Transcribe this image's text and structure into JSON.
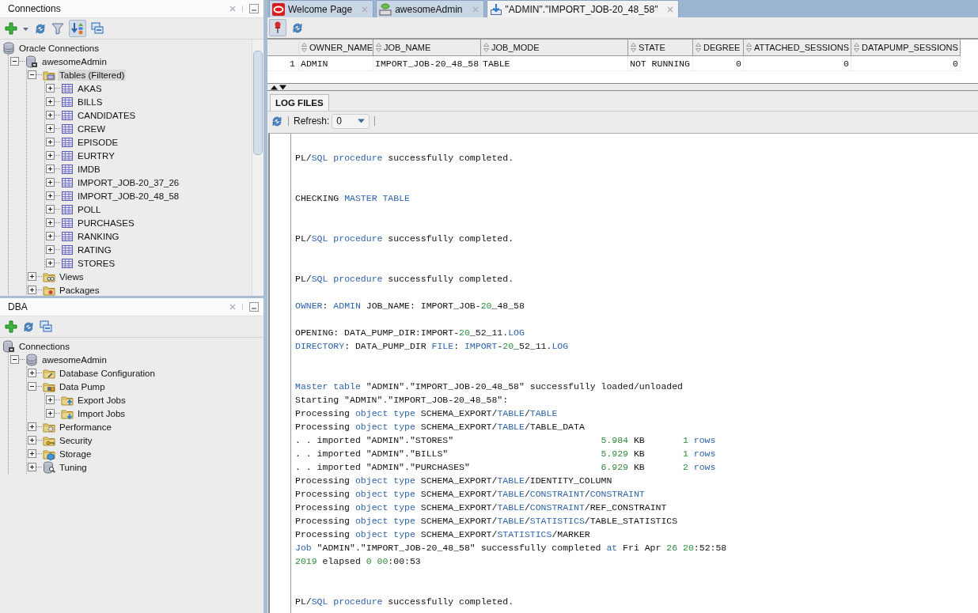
{
  "connections_panel": {
    "title": "Connections",
    "tree": [
      {
        "label": "Oracle Connections",
        "kind": "database",
        "selected": false,
        "children": [
          {
            "label": "awesomeAdmin",
            "kind": "connection",
            "expanded": true,
            "selected": false,
            "children": [
              {
                "label": "Tables (Filtered)",
                "kind": "tablefolder",
                "expanded": true,
                "selected": true,
                "children": [
                  {
                    "label": "AKAS",
                    "kind": "table",
                    "expanded": false,
                    "selected": false
                  },
                  {
                    "label": "BILLS",
                    "kind": "table",
                    "expanded": false,
                    "selected": false
                  },
                  {
                    "label": "CANDIDATES",
                    "kind": "table",
                    "expanded": false,
                    "selected": false
                  },
                  {
                    "label": "CREW",
                    "kind": "table",
                    "expanded": false,
                    "selected": false
                  },
                  {
                    "label": "EPISODE",
                    "kind": "table",
                    "expanded": false,
                    "selected": false
                  },
                  {
                    "label": "EURTRY",
                    "kind": "table",
                    "expanded": false,
                    "selected": false
                  },
                  {
                    "label": "IMDB",
                    "kind": "table",
                    "expanded": false,
                    "selected": false
                  },
                  {
                    "label": "IMPORT_JOB-20_37_26",
                    "kind": "table",
                    "expanded": false,
                    "selected": false
                  },
                  {
                    "label": "IMPORT_JOB-20_48_58",
                    "kind": "table",
                    "expanded": false,
                    "selected": false
                  },
                  {
                    "label": "POLL",
                    "kind": "table",
                    "expanded": false,
                    "selected": false
                  },
                  {
                    "label": "PURCHASES",
                    "kind": "table",
                    "expanded": false,
                    "selected": false
                  },
                  {
                    "label": "RANKING",
                    "kind": "table",
                    "expanded": false,
                    "selected": false
                  },
                  {
                    "label": "RATING",
                    "kind": "table",
                    "expanded": false,
                    "selected": false
                  },
                  {
                    "label": "STORES",
                    "kind": "table",
                    "expanded": false,
                    "selected": false
                  }
                ]
              },
              {
                "label": "Views",
                "kind": "viewsfolder",
                "expanded": false,
                "selected": false
              },
              {
                "label": "Packages",
                "kind": "packagesfolder",
                "expanded": false,
                "selected": false
              }
            ]
          }
        ]
      }
    ]
  },
  "dba_panel": {
    "title": "DBA",
    "tree": [
      {
        "label": "Connections",
        "kind": "connection",
        "selected": false,
        "children": [
          {
            "label": "awesomeAdmin",
            "kind": "database",
            "expanded": true,
            "selected": false,
            "children": [
              {
                "label": "Database Configuration",
                "kind": "configfolder",
                "expanded": false,
                "selected": false
              },
              {
                "label": "Data Pump",
                "kind": "pumpfolder",
                "expanded": true,
                "selected": false,
                "children": [
                  {
                    "label": "Export Jobs",
                    "kind": "exportfolder",
                    "expanded": false,
                    "selected": false
                  },
                  {
                    "label": "Import Jobs",
                    "kind": "importfolder",
                    "expanded": false,
                    "selected": false
                  }
                ]
              },
              {
                "label": "Performance",
                "kind": "gearfolder",
                "expanded": false,
                "selected": false
              },
              {
                "label": "Security",
                "kind": "keyfolder",
                "expanded": false,
                "selected": false
              },
              {
                "label": "Storage",
                "kind": "storagefolder",
                "expanded": false,
                "selected": false
              },
              {
                "label": "Tuning",
                "kind": "tuning",
                "expanded": false,
                "selected": false
              }
            ]
          }
        ]
      }
    ]
  },
  "editor_tabs": [
    {
      "label": "Welcome Page",
      "kind": "welcome",
      "selected": false
    },
    {
      "label": "awesomeAdmin",
      "kind": "worksheet",
      "selected": false
    },
    {
      "label": "\"ADMIN\".\"IMPORT_JOB-20_48_58\"",
      "kind": "importjob",
      "selected": true
    }
  ],
  "job_table": {
    "columns": [
      {
        "label": "OWNER_NAME",
        "kind": "text"
      },
      {
        "label": "JOB_NAME",
        "kind": "text"
      },
      {
        "label": "JOB_MODE",
        "kind": "text"
      },
      {
        "label": "STATE",
        "kind": "text"
      },
      {
        "label": "DEGREE",
        "kind": "number"
      },
      {
        "label": "ATTACHED_SESSIONS",
        "kind": "number"
      },
      {
        "label": "DATAPUMP_SESSIONS",
        "kind": "number"
      }
    ],
    "rows": [
      {
        "number": "1",
        "cells": [
          "ADMIN",
          "IMPORT_JOB-20_48_58",
          "TABLE",
          "NOT RUNNING",
          "0",
          "0",
          "0"
        ]
      }
    ]
  },
  "log_tab": {
    "label": "LOG FILES",
    "selected": true
  },
  "refresh": {
    "label": "Refresh:",
    "value": "0"
  },
  "log_lines": [
    {
      "kind": "blank"
    },
    {
      "kind": "text",
      "segments": [
        {
          "text": "PL/",
          "kind": "plain"
        },
        {
          "text": "SQL procedure",
          "kind": "keyword"
        },
        {
          "text": " successfully completed.",
          "kind": "plain"
        }
      ]
    },
    {
      "kind": "blank"
    },
    {
      "kind": "blank"
    },
    {
      "kind": "text",
      "segments": [
        {
          "text": "CHECKING ",
          "kind": "plain"
        },
        {
          "text": "MASTER TABLE",
          "kind": "keyword"
        }
      ]
    },
    {
      "kind": "blank"
    },
    {
      "kind": "blank"
    },
    {
      "kind": "text",
      "segments": [
        {
          "text": "PL/",
          "kind": "plain"
        },
        {
          "text": "SQL procedure",
          "kind": "keyword"
        },
        {
          "text": " successfully completed.",
          "kind": "plain"
        }
      ]
    },
    {
      "kind": "blank"
    },
    {
      "kind": "blank"
    },
    {
      "kind": "text",
      "segments": [
        {
          "text": "PL/",
          "kind": "plain"
        },
        {
          "text": "SQL procedure",
          "kind": "keyword"
        },
        {
          "text": " successfully completed.",
          "kind": "plain"
        }
      ]
    },
    {
      "kind": "blank"
    },
    {
      "kind": "text",
      "segments": [
        {
          "text": "OWNER",
          "kind": "keyword"
        },
        {
          "text": ": ",
          "kind": "plain"
        },
        {
          "text": "ADMIN",
          "kind": "keyword"
        },
        {
          "text": " JOB_NAME: IMPORT_JOB-",
          "kind": "plain"
        },
        {
          "text": "20",
          "kind": "number"
        },
        {
          "text": "_48_58",
          "kind": "plain"
        }
      ]
    },
    {
      "kind": "blank"
    },
    {
      "kind": "text",
      "segments": [
        {
          "text": "OPENING: DATA_PUMP_DIR:IMPORT-",
          "kind": "plain"
        },
        {
          "text": "20",
          "kind": "number"
        },
        {
          "text": "_52_11.",
          "kind": "plain"
        },
        {
          "text": "LOG",
          "kind": "keyword"
        }
      ]
    },
    {
      "kind": "text",
      "segments": [
        {
          "text": "DIRECTORY",
          "kind": "keyword"
        },
        {
          "text": ": DATA_PUMP_DIR ",
          "kind": "plain"
        },
        {
          "text": "FILE",
          "kind": "keyword"
        },
        {
          "text": ": ",
          "kind": "plain"
        },
        {
          "text": "IMPORT",
          "kind": "keyword"
        },
        {
          "text": "-",
          "kind": "plain"
        },
        {
          "text": "20",
          "kind": "number"
        },
        {
          "text": "_52_11.",
          "kind": "plain"
        },
        {
          "text": "LOG",
          "kind": "keyword"
        }
      ]
    },
    {
      "kind": "blank"
    },
    {
      "kind": "blank"
    },
    {
      "kind": "text",
      "segments": [
        {
          "text": "Master table",
          "kind": "keyword"
        },
        {
          "text": " \"ADMIN\".\"IMPORT_JOB-20_48_58\" successfully loaded/unloaded",
          "kind": "plain"
        }
      ]
    },
    {
      "kind": "text",
      "segments": [
        {
          "text": "Starting \"ADMIN\".\"IMPORT_JOB-20_48_58\":",
          "kind": "plain"
        }
      ]
    },
    {
      "kind": "text",
      "segments": [
        {
          "text": "Processing ",
          "kind": "plain"
        },
        {
          "text": "object type",
          "kind": "keyword"
        },
        {
          "text": " SCHEMA_EXPORT/",
          "kind": "plain"
        },
        {
          "text": "TABLE",
          "kind": "keyword"
        },
        {
          "text": "/",
          "kind": "plain"
        },
        {
          "text": "TABLE",
          "kind": "keyword"
        }
      ]
    },
    {
      "kind": "text",
      "segments": [
        {
          "text": "Processing ",
          "kind": "plain"
        },
        {
          "text": "object type",
          "kind": "keyword"
        },
        {
          "text": " SCHEMA_EXPORT/",
          "kind": "plain"
        },
        {
          "text": "TABLE",
          "kind": "keyword"
        },
        {
          "text": "/TABLE_DATA",
          "kind": "plain"
        }
      ]
    },
    {
      "kind": "text",
      "segments": [
        {
          "text": ". . imported \"ADMIN\".\"STORES\"                           ",
          "kind": "plain"
        },
        {
          "text": "5.984",
          "kind": "number"
        },
        {
          "text": " KB       ",
          "kind": "plain"
        },
        {
          "text": "1",
          "kind": "number"
        },
        {
          "text": " rows",
          "kind": "keyword"
        }
      ]
    },
    {
      "kind": "text",
      "segments": [
        {
          "text": ". . imported \"ADMIN\".\"BILLS\"                            ",
          "kind": "plain"
        },
        {
          "text": "5.929",
          "kind": "number"
        },
        {
          "text": " KB       ",
          "kind": "plain"
        },
        {
          "text": "1",
          "kind": "number"
        },
        {
          "text": " rows",
          "kind": "keyword"
        }
      ]
    },
    {
      "kind": "text",
      "segments": [
        {
          "text": ". . imported \"ADMIN\".\"PURCHASES\"                        ",
          "kind": "plain"
        },
        {
          "text": "6.929",
          "kind": "number"
        },
        {
          "text": " KB       ",
          "kind": "plain"
        },
        {
          "text": "2",
          "kind": "number"
        },
        {
          "text": " rows",
          "kind": "keyword"
        }
      ]
    },
    {
      "kind": "text",
      "segments": [
        {
          "text": "Processing ",
          "kind": "plain"
        },
        {
          "text": "object type",
          "kind": "keyword"
        },
        {
          "text": " SCHEMA_EXPORT/",
          "kind": "plain"
        },
        {
          "text": "TABLE",
          "kind": "keyword"
        },
        {
          "text": "/IDENTITY_COLUMN",
          "kind": "plain"
        }
      ]
    },
    {
      "kind": "text",
      "segments": [
        {
          "text": "Processing ",
          "kind": "plain"
        },
        {
          "text": "object type",
          "kind": "keyword"
        },
        {
          "text": " SCHEMA_EXPORT/",
          "kind": "plain"
        },
        {
          "text": "TABLE",
          "kind": "keyword"
        },
        {
          "text": "/",
          "kind": "plain"
        },
        {
          "text": "CONSTRAINT",
          "kind": "keyword"
        },
        {
          "text": "/",
          "kind": "plain"
        },
        {
          "text": "CONSTRAINT",
          "kind": "keyword"
        }
      ]
    },
    {
      "kind": "text",
      "segments": [
        {
          "text": "Processing ",
          "kind": "plain"
        },
        {
          "text": "object type",
          "kind": "keyword"
        },
        {
          "text": " SCHEMA_EXPORT/",
          "kind": "plain"
        },
        {
          "text": "TABLE",
          "kind": "keyword"
        },
        {
          "text": "/",
          "kind": "plain"
        },
        {
          "text": "CONSTRAINT",
          "kind": "keyword"
        },
        {
          "text": "/REF_CONSTRAINT",
          "kind": "plain"
        }
      ]
    },
    {
      "kind": "text",
      "segments": [
        {
          "text": "Processing ",
          "kind": "plain"
        },
        {
          "text": "object type",
          "kind": "keyword"
        },
        {
          "text": " SCHEMA_EXPORT/",
          "kind": "plain"
        },
        {
          "text": "TABLE",
          "kind": "keyword"
        },
        {
          "text": "/",
          "kind": "plain"
        },
        {
          "text": "STATISTICS",
          "kind": "keyword"
        },
        {
          "text": "/TABLE_STATISTICS",
          "kind": "plain"
        }
      ]
    },
    {
      "kind": "text",
      "segments": [
        {
          "text": "Processing ",
          "kind": "plain"
        },
        {
          "text": "object type",
          "kind": "keyword"
        },
        {
          "text": " SCHEMA_EXPORT/",
          "kind": "plain"
        },
        {
          "text": "STATISTICS",
          "kind": "keyword"
        },
        {
          "text": "/MARKER",
          "kind": "plain"
        }
      ]
    },
    {
      "kind": "text",
      "segments": [
        {
          "text": "Job",
          "kind": "keyword"
        },
        {
          "text": " \"ADMIN\".\"IMPORT_JOB-20_48_58\" successfully completed ",
          "kind": "plain"
        },
        {
          "text": "at",
          "kind": "keyword"
        },
        {
          "text": " Fri Apr ",
          "kind": "plain"
        },
        {
          "text": "26 20",
          "kind": "number"
        },
        {
          "text": ":52:58",
          "kind": "plain"
        }
      ]
    },
    {
      "kind": "text",
      "segments": [
        {
          "text": "2019",
          "kind": "number"
        },
        {
          "text": " elapsed ",
          "kind": "plain"
        },
        {
          "text": "0 00",
          "kind": "number"
        },
        {
          "text": ":00:53",
          "kind": "plain"
        }
      ]
    },
    {
      "kind": "blank"
    },
    {
      "kind": "blank"
    },
    {
      "kind": "text",
      "segments": [
        {
          "text": "PL/",
          "kind": "plain"
        },
        {
          "text": "SQL procedure",
          "kind": "keyword"
        },
        {
          "text": " successfully completed.",
          "kind": "plain"
        }
      ]
    }
  ]
}
